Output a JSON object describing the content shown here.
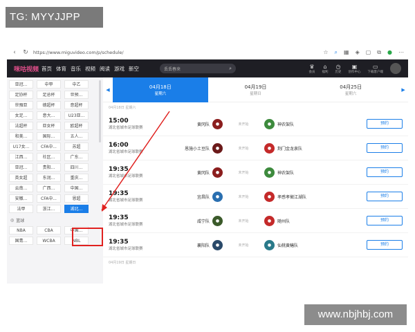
{
  "watermarks": {
    "top": "TG: MYYJJPP",
    "bottom": "www.nbjhbj.com"
  },
  "browser": {
    "url": "https://www.miguvideo.com/p/schedule/"
  },
  "header": {
    "logo": "咪咕视频",
    "menu": [
      "首页",
      "体育",
      "音乐",
      "视频",
      "阅读",
      "游戏",
      "新空"
    ],
    "search_placeholder": "丢丢春来",
    "tools": [
      "会员",
      "福利",
      "历史",
      "创作中心",
      "下载客户端"
    ]
  },
  "sidebar": {
    "football_items": [
      "亚冠...",
      "中甲",
      "中乙",
      "足协杯",
      "足总杯",
      "世预...",
      "世預亚",
      "德超杯",
      "意超杯",
      "女足...",
      "意大...",
      "U23亚...",
      "法超杯",
      "亚女杯",
      "欧超杯",
      "和美...",
      "国际...",
      "五人...",
      "U17女...",
      "CFA中...",
      "苏超",
      "江西...",
      "社区...",
      "广东...",
      "亚冠...",
      "贵阳...",
      "四川...",
      "英女超",
      "东润...",
      "重庆...",
      "云南...",
      "广西...",
      "中国...",
      "安徽...",
      "CFA中...",
      "恩超",
      "法甲",
      "浙江...",
      "湖北..."
    ],
    "basketball_label": "篮球",
    "basketball_items": [
      "NBA",
      "CBA",
      "中国...",
      "国青...",
      "WCBA",
      "NBL"
    ]
  },
  "dates": [
    {
      "date": "04月18日",
      "weekday": "星期六"
    },
    {
      "date": "04月19日",
      "weekday": "星期日"
    },
    {
      "date": "04月25日",
      "weekday": "星期六"
    }
  ],
  "day_header": "04月18日 星期六",
  "next_day_header": "04月19日 星期日",
  "matches": [
    {
      "time": "15:00",
      "league": "湖北省城市足球联赛",
      "home": "黄冈队",
      "away": "神农架队",
      "status": "未开始",
      "book": "预约"
    },
    {
      "time": "16:00",
      "league": "湖北省城市足球联赛",
      "home": "恩施小土豆队",
      "away": "荆门金龙泉队",
      "status": "未开始",
      "book": "预约"
    },
    {
      "time": "19:35",
      "league": "湖北省城市足球联赛",
      "home": "黄冈队",
      "away": "神农架队",
      "status": "未开始",
      "book": "预约"
    },
    {
      "time": "19:35",
      "league": "湖北省城市足球联赛",
      "home": "宜昌队",
      "away": "孝感孝徵江湖队",
      "status": "未开始",
      "book": "预约"
    },
    {
      "time": "19:35",
      "league": "湖北省城市足球联赛",
      "home": "咸宁队",
      "away": "随州队",
      "status": "未开始",
      "book": "预约"
    },
    {
      "time": "19:35",
      "league": "湖北省城市足球联赛",
      "home": "襄阳队",
      "away": "仙桃黄鳝队",
      "status": "未开始",
      "book": "预约"
    }
  ],
  "colors": {
    "accent": "#1a7ee8",
    "highlight": "#e0211f",
    "topbar": "#1e1e24"
  }
}
